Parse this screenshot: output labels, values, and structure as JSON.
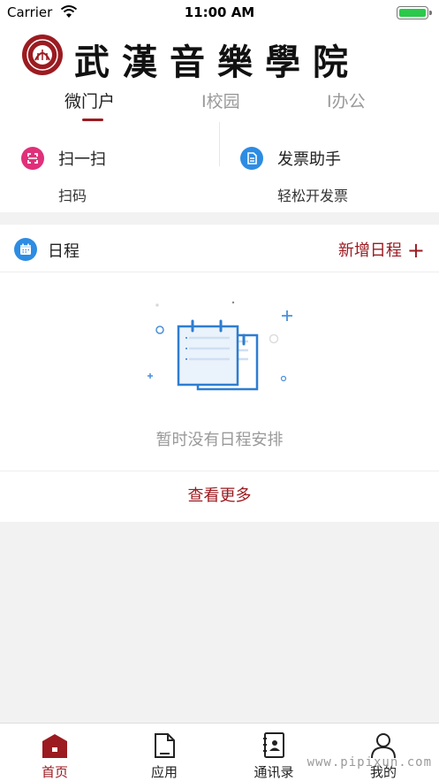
{
  "status_bar": {
    "carrier": "Carrier",
    "time": "11:00 AM"
  },
  "header": {
    "school_name": "武漢音樂學院",
    "tabs": [
      {
        "label": "微门户",
        "active": true
      },
      {
        "label": "I校园",
        "active": false
      },
      {
        "label": "I办公",
        "active": false
      }
    ]
  },
  "quick_actions": [
    {
      "title": "扫一扫",
      "subtitle": "扫码",
      "icon": "scan-icon",
      "color": "#e0307a"
    },
    {
      "title": "发票助手",
      "subtitle": "轻松开发票",
      "icon": "invoice-icon",
      "color": "#2d8ce3"
    }
  ],
  "schedule": {
    "title": "日程",
    "add_label": "新增日程",
    "add_icon": "plus-icon",
    "empty_text": "暂时没有日程安排",
    "more_label": "查看更多"
  },
  "tab_bar": [
    {
      "label": "首页",
      "icon": "home-icon",
      "active": true
    },
    {
      "label": "应用",
      "icon": "document-icon",
      "active": false
    },
    {
      "label": "通讯录",
      "icon": "contacts-icon",
      "active": false
    },
    {
      "label": "我的",
      "icon": "user-icon",
      "active": false
    }
  ],
  "watermark": "www.pipixun.com",
  "colors": {
    "brand": "#9b1b21",
    "accent_blue": "#2d8ce3",
    "scan_pink": "#e0307a",
    "background": "#f2f2f2"
  }
}
